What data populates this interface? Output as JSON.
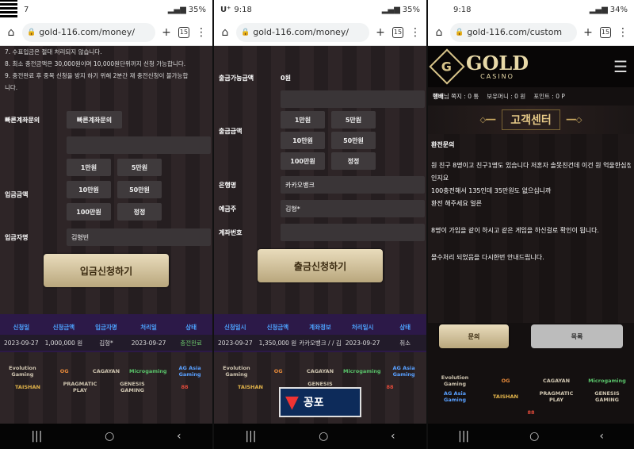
{
  "p1": {
    "time": "7",
    "battery": "35%",
    "url": "gold-116.com/money/",
    "notes": [
      "7. 수표입금은 절대 처리되지 않습니다.",
      "8. 최소 충전금액은 30,000원이며 10,000원단위까지 신청 가능합니다.",
      "9. 충전완료 후 중복 신청을 방지 하기 위해 2분간 재 충전신청이 불가능합",
      "니다."
    ],
    "quick_label": "빠른계좌문의",
    "quick_btn": "빠른계좌문의",
    "amount_label": "입금금액",
    "amounts": [
      "1만원",
      "5만원",
      "10만원",
      "50만원",
      "100만원",
      "정정"
    ],
    "depositor_label": "입금자명",
    "depositor": "김형빈",
    "submit": "입금신청하기",
    "cols": [
      "신청일",
      "신청금액",
      "입금자명",
      "처리일",
      "상태"
    ],
    "row": [
      "2023-09-27",
      "1,000,000 원",
      "김형*",
      "2023-09-27",
      "충전완료"
    ]
  },
  "p2": {
    "time": "9:18",
    "battery": "35%",
    "url": "gold-116.com/money/",
    "avail_label": "출금가능금액",
    "avail": "0원",
    "amount_label": "출금금액",
    "amounts": [
      "1만원",
      "5만원",
      "10만원",
      "50만원",
      "100만원",
      "정정"
    ],
    "bank_label": "은행명",
    "bank": "카카오뱅크",
    "holder_label": "예금주",
    "holder": "김형*",
    "acct_label": "계좌번호",
    "submit": "출금신청하기",
    "cols": [
      "신청일시",
      "신청금액",
      "계좌정보",
      "처리일시",
      "상태"
    ],
    "row": [
      "2023-09-27",
      "1,350,000 원",
      "카카오뱅크 / / 김형*",
      "2023-09-27",
      "취소"
    ]
  },
  "p3": {
    "time": "9:18",
    "battery": "34%",
    "url": "gold-116.com/custom",
    "brand": "GOLD",
    "brand_sub": "CASINO",
    "info": {
      "user": "행배",
      "user_suffix": "님 쪽지 : 0 통",
      "money": "보유머니 : 0 원",
      "point": "포인트 : 0 P"
    },
    "banner": "고객센터",
    "subject": "환전문의",
    "body": [
      "원 친구 8명이고 친구1명도 있습니다 저혼자 솔못친건데 이건 원 억울한심정",
      "인지요",
      "100충전해서 135인데 35만원도 없으십니까",
      "환전 해주세요 얼른",
      "8명이 가입을 같이 하시고 같은 게임을 하신걸로 확인이 됩니다.",
      "몰수처리 되었음을 다시한번 안내드립니다."
    ],
    "btn_reply": "문의",
    "btn_list": "목록"
  },
  "logos": [
    "Evolution Gaming",
    "OG",
    "CAGAYAN",
    "Microgaming",
    "",
    "AG Asia Gaming",
    "TAISHAN",
    "PRAGMATIC PLAY",
    "GENESIS GAMING",
    "88"
  ],
  "watermark": "꽁포"
}
